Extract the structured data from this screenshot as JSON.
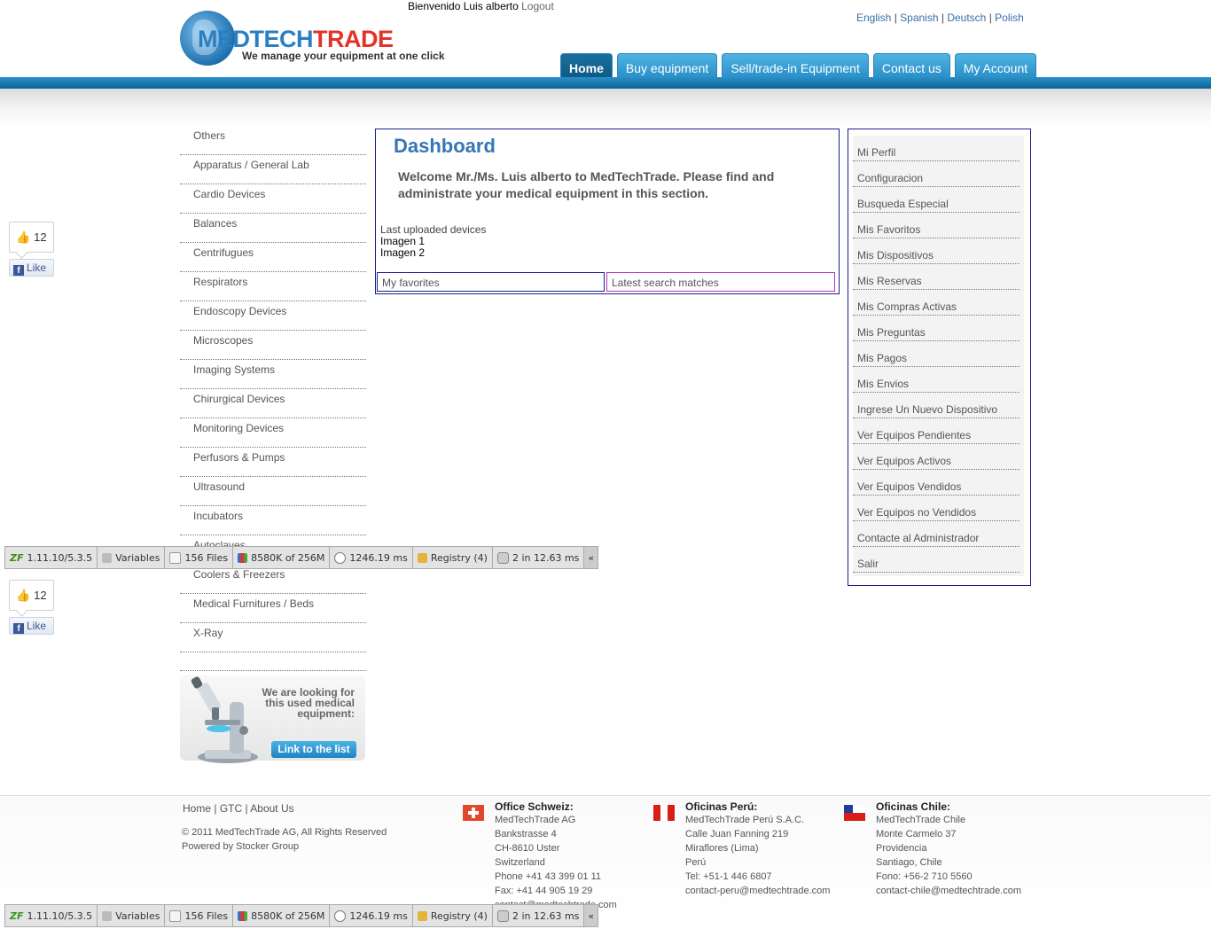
{
  "header": {
    "logo": {
      "brand_med": "MEDTECH",
      "brand_trade": "TRADE",
      "slogan": "We manage your equipment at one click"
    },
    "welcome_text": "Bienvenido Luis alberto",
    "logout_label": "Logout",
    "languages": [
      "English",
      "Spanish",
      "Deutsch",
      "Polish"
    ],
    "nav_tabs": [
      {
        "label": "Home",
        "active": true
      },
      {
        "label": "Buy equipment"
      },
      {
        "label": "Sell/trade-in Equipment"
      },
      {
        "label": "Contact us"
      },
      {
        "label": "My Account"
      }
    ]
  },
  "categories": [
    "Others",
    "Apparatus / General Lab",
    "Cardio Devices",
    "Balances",
    "Centrifugues",
    "Respirators",
    "Endoscopy Devices",
    "Microscopes",
    "Imaging Systems",
    "Chirurgical Devices",
    "Monitoring Devices",
    "Perfusors & Pumps",
    "Ultrasound",
    "Incubators",
    "Autoclaves",
    "Coolers & Freezers",
    "Medical Furnitures / Beds",
    "X-Ray"
  ],
  "seeking_box": {
    "text": "We are looking for this used medical equipment:",
    "button_label": "Link to the list"
  },
  "like_widgets": [
    {
      "count": "12",
      "button_label": "Like"
    },
    {
      "count": "12",
      "button_label": "Like"
    }
  ],
  "dashboard": {
    "title": "Dashboard",
    "welcome": "Welcome Mr./Ms. Luis alberto to MedTechTrade. Please find and administrate your medical equipment in this section.",
    "last_uploaded_label": "Last uploaded devices",
    "last_uploaded": [
      "Imagen 1",
      "Imagen 2"
    ],
    "favorites_label": "My favorites",
    "search_matches_label": "Latest search matches"
  },
  "account_menu": [
    "Mi Perfil",
    "Configuracion",
    "Busqueda Especial",
    "Mis Favoritos",
    "Mis Dispositivos",
    "Mis Reservas",
    "Mis Compras Activas",
    "Mis Preguntas",
    "Mis Pagos",
    "Mis Envios",
    "Ingrese Un Nuevo Dispositivo",
    "Ver Equipos Pendientes",
    "Ver Equipos Activos",
    "Ver Equipos Vendidos",
    "Ver Equipos no Vendidos",
    "Contacte al Administrador",
    "Salir"
  ],
  "debug_toolbar": {
    "version": "1.11.10/5.3.5",
    "variables": "Variables",
    "files": "156 Files",
    "memory": "8580K of 256M",
    "time": "1246.19 ms",
    "registry": "Registry (4)",
    "db": "2 in 12.63 ms",
    "collapse": "«"
  },
  "footer": {
    "links": [
      "Home",
      "GTC",
      "About Us"
    ],
    "copyright": "© 2011 MedTechTrade AG, All Rights Reserved",
    "powered": "Powered by Stocker Group",
    "offices": [
      {
        "heading": "Office Schweiz:",
        "lines": [
          "MedTechTrade AG",
          "Bankstrasse 4",
          "CH-8610 Uster",
          "Switzerland",
          "Phone +41 43 399 01 11",
          "Fax: +41 44 905 19 29",
          "contact@medtechtrade.com"
        ]
      },
      {
        "heading": "Oficinas Perú:",
        "lines": [
          "MedTechTrade Perú S.A.C.",
          "Calle Juan Fanning 219",
          "Miraflores (Lima)",
          "Perú",
          "Tel: +51-1 446 6807",
          "contact-peru@medtechtrade.com"
        ]
      },
      {
        "heading": "Oficinas Chile:",
        "lines": [
          "MedTechTrade Chile",
          "Monte Carmelo 37",
          "Providencia",
          "Santiago, Chile",
          "Fono: +56-2 710 5560",
          "contact-chile@medtechtrade.com"
        ]
      }
    ]
  }
}
